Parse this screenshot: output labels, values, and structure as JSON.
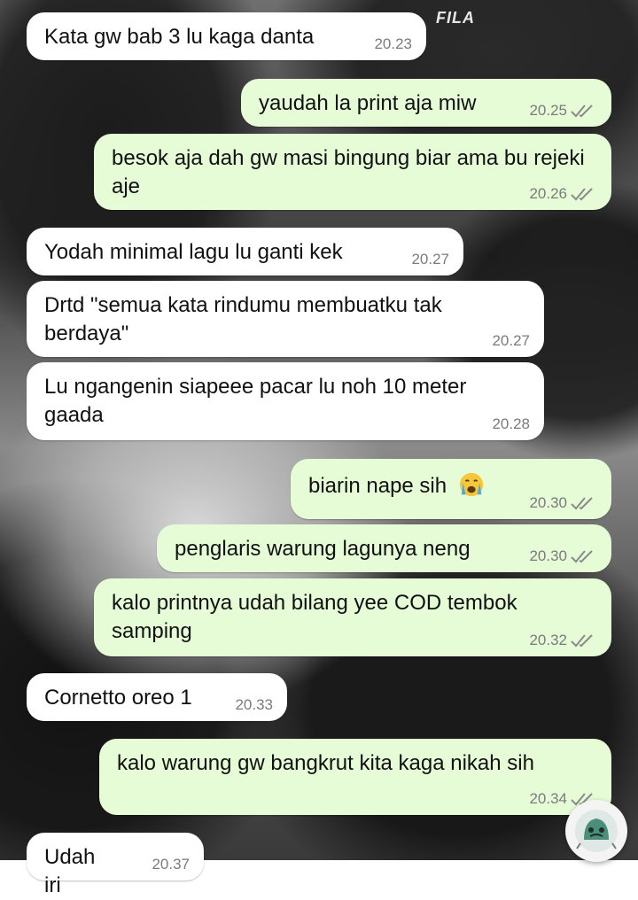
{
  "wallpaper": {
    "brand_text": "FILA"
  },
  "messages": [
    {
      "direction": "in",
      "text": "Kata gw bab 3 lu kaga danta",
      "time": "20.23"
    },
    {
      "direction": "out",
      "text": "yaudah la print aja miw",
      "time": "20.25",
      "status": "read"
    },
    {
      "direction": "out",
      "text": "besok aja dah gw masi bingung biar ama bu rejeki aje",
      "time": "20.26",
      "status": "read"
    },
    {
      "direction": "in",
      "text": "Yodah minimal lagu lu ganti kek",
      "time": "20.27"
    },
    {
      "direction": "in",
      "text": "Drtd \"semua kata rindumu membuatku tak berdaya\"",
      "time": "20.27"
    },
    {
      "direction": "in",
      "text": "Lu ngangenin siapeee pacar lu noh 10 meter gaada",
      "time": "20.28"
    },
    {
      "direction": "out",
      "text": "biarin nape sih",
      "emoji": "crying-face",
      "time": "20.30",
      "status": "read"
    },
    {
      "direction": "out",
      "text": "penglaris warung lagunya neng",
      "time": "20.30",
      "status": "read"
    },
    {
      "direction": "out",
      "text": "kalo printnya udah bilang yee COD tembok samping",
      "time": "20.32",
      "status": "read"
    },
    {
      "direction": "in",
      "text": "Cornetto oreo 1",
      "time": "20.33"
    },
    {
      "direction": "out",
      "text": "kalo warung gw bangkrut kita kaga nikah sih",
      "time": "20.34",
      "status": "read"
    },
    {
      "direction": "in",
      "text": "Udah iri",
      "time": "20.37"
    }
  ],
  "colors": {
    "incoming_bubble": "#ffffff",
    "outgoing_bubble": "#e5fcd6",
    "read_tick": "#8a8a8a",
    "timestamp": "#7b7b7b"
  },
  "floating_button": {
    "icon": "sticker-face-icon"
  }
}
